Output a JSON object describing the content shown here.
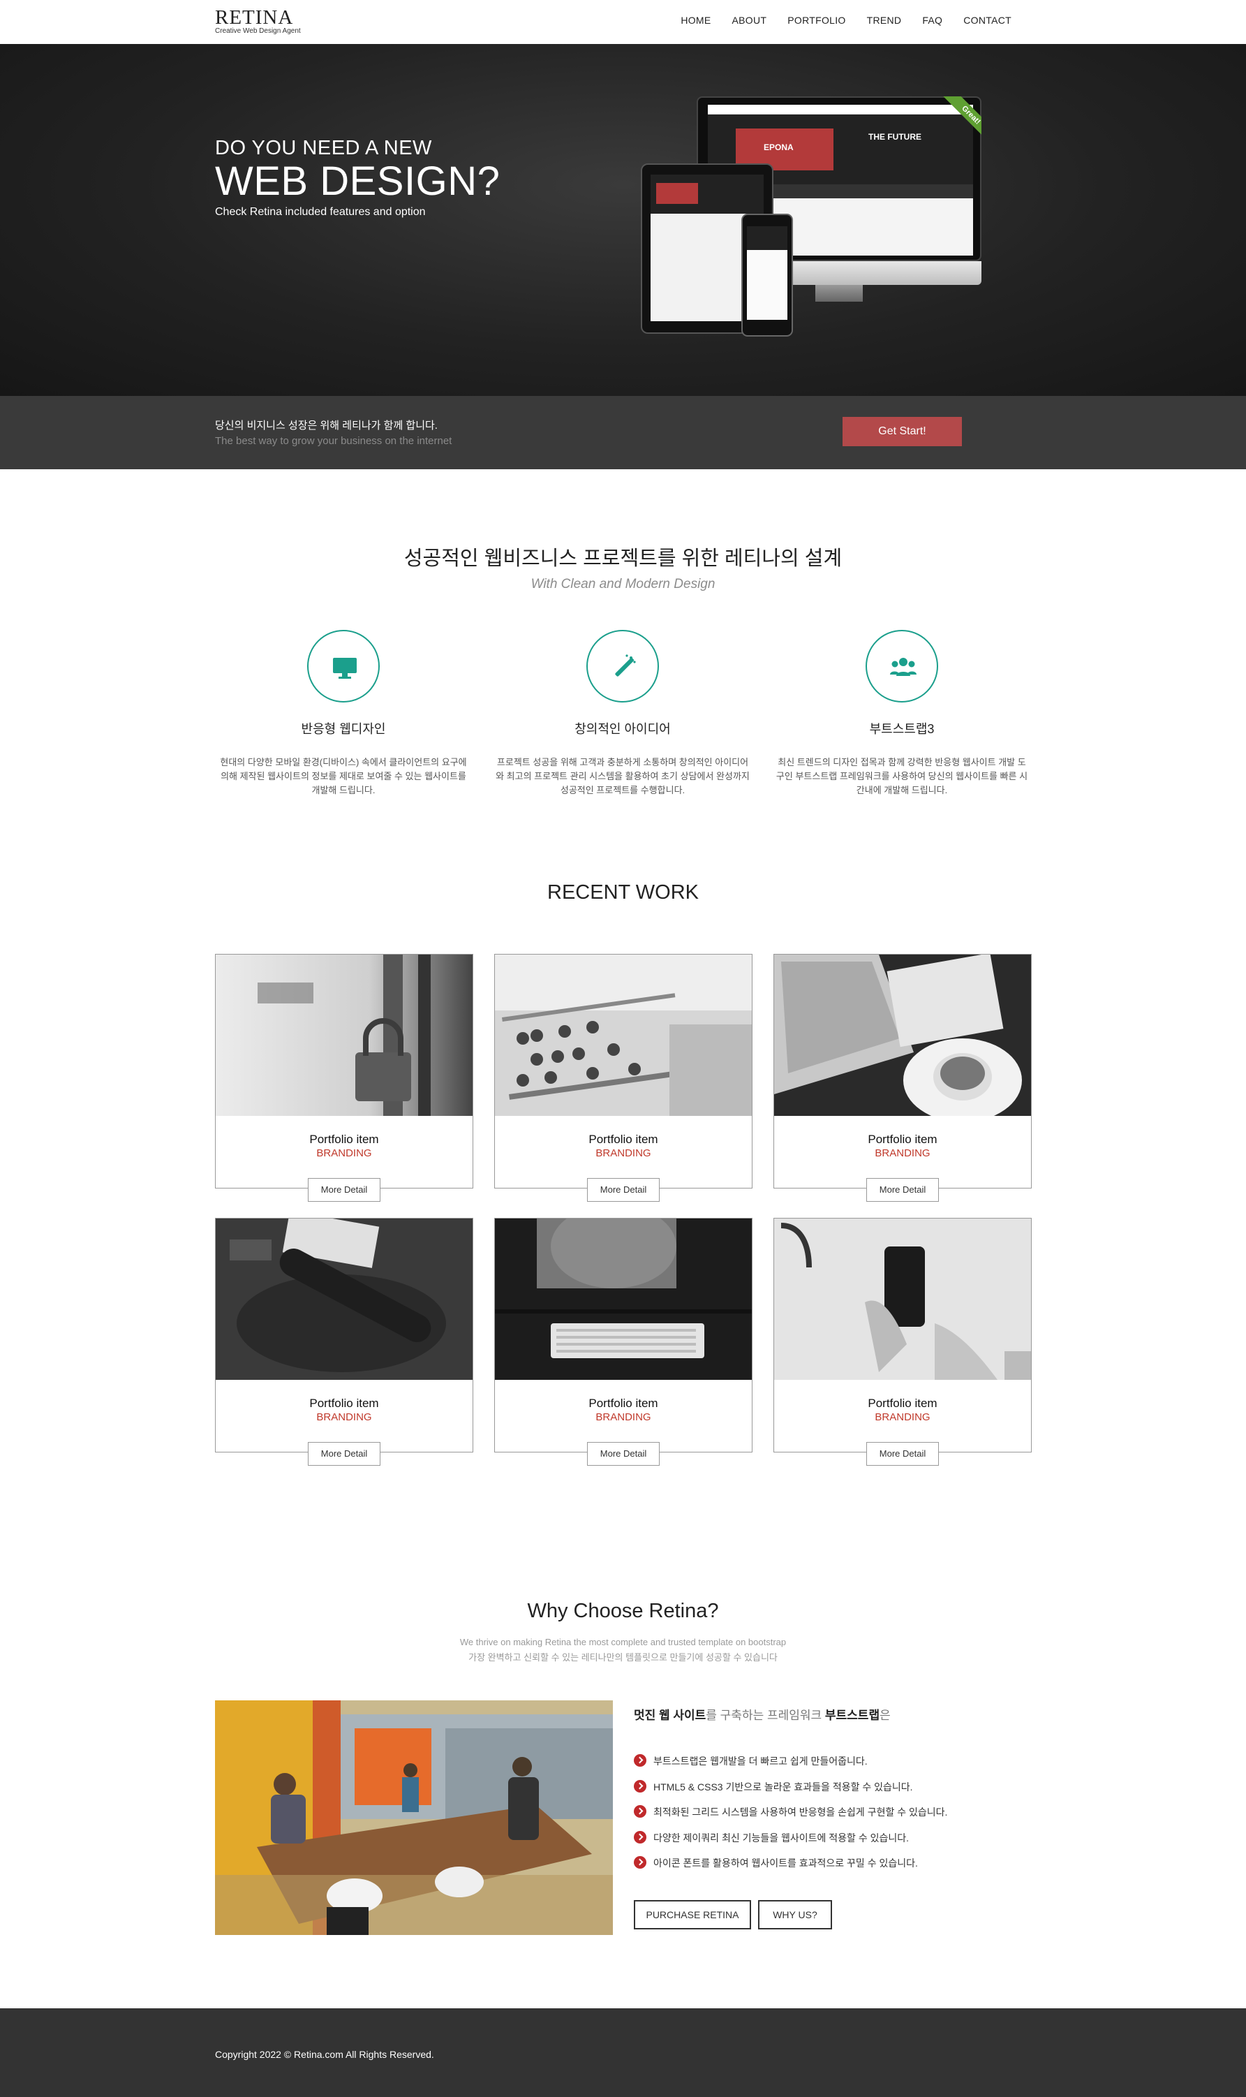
{
  "header": {
    "logo_title": "RETINA",
    "logo_sub": "Creative Web Design Agent",
    "nav": [
      "HOME",
      "ABOUT",
      "PORTFOLIO",
      "TREND",
      "FAQ",
      "CONTACT"
    ]
  },
  "hero": {
    "pre": "DO YOU NEED A NEW",
    "title": "WEB DESIGN?",
    "sub": "Check Retina included features and option",
    "ribbon": "Great!",
    "screen_brand": "EPONA",
    "screen_headline": "THE FUTURE"
  },
  "strip": {
    "kr": "당신의 비지니스 성장은 위해 레티나가 함께 합니다.",
    "en": "The best way to grow your business on the internet",
    "button": "Get Start!"
  },
  "features": {
    "title": "성공적인 웹비즈니스 프로젝트를 위한 레티나의 설계",
    "sub": "With Clean and Modern Design",
    "items": [
      {
        "icon": "monitor-icon",
        "title": "반응형 웹디자인",
        "text": "현대의 다양한 모바일 환경(디바이스) 속에서 클라이언트의 요구에 의해 제작된 웹사이트의 정보를 제대로 보여줄 수 있는 웹사이트를 개발해 드립니다."
      },
      {
        "icon": "magic-wand-icon",
        "title": "창의적인 아이디어",
        "text": "프로젝트 성공을 위해 고객과 충분하게 소통하며 창의적인 아이디어와 최고의 프로젝트 관리 시스템을 활용하여 초기 상담에서 완성까지 성공적인 프로젝트를 수행합니다."
      },
      {
        "icon": "users-icon",
        "title": "부트스트랩3",
        "text": "최신 트렌드의 디자인 접목과 함께 강력한 반응형 웹사이트 개발 도구인 부트스트랩 프레임워크를 사용하여 당신의 웹사이트를 빠른 시간내에 개발해 드립니다."
      }
    ]
  },
  "recent_work": {
    "title": "RECENT WORK",
    "items": [
      {
        "title": "Portfolio item",
        "category": "BRANDING",
        "button": "More Detail",
        "image": "padlock-photo"
      },
      {
        "title": "Portfolio item",
        "category": "BRANDING",
        "button": "More Detail",
        "image": "abacus-photo"
      },
      {
        "title": "Portfolio item",
        "category": "BRANDING",
        "button": "More Detail",
        "image": "laptop-coffee-photo"
      },
      {
        "title": "Portfolio item",
        "category": "BRANDING",
        "button": "More Detail",
        "image": "rolling-pin-photo"
      },
      {
        "title": "Portfolio item",
        "category": "BRANDING",
        "button": "More Detail",
        "image": "keyboard-photo"
      },
      {
        "title": "Portfolio item",
        "category": "BRANDING",
        "button": "More Detail",
        "image": "smartphone-photo"
      }
    ]
  },
  "why": {
    "title": "Why Choose Retina?",
    "sub_en": "We thrive on making Retina the most complete and trusted template on bootstrap",
    "sub_kr": "가장 완벽하고 신뢰할 수 있는 레티나만의 템플릿으로 만들기에 성공할 수 있습니다",
    "head_a": "멋진 웹 사이트",
    "head_b": "를 구축하는 프레임워크",
    "head_c": "부트스트랩",
    "head_d": "은",
    "list": [
      "부트스트랩은 웹개발을 더 빠르고 쉽게 만들어줍니다.",
      "HTML5 & CSS3 기반으로 놀라운 효과들을 적용할 수 있습니다.",
      "최적화된 그리드 시스템을 사용하여 반응형을 손쉽게 구현할 수 있습니다.",
      "다양한 제이쿼리 최신 기능들을 웹사이트에 적용할 수 있습니다.",
      "아이콘 폰트를 활용하여 웹사이트를 효과적으로 꾸밀 수 있습니다."
    ],
    "btn_purchase": "PURCHASE RETINA",
    "btn_why": "WHY US?"
  },
  "footer": {
    "copyright": "Copyright 2022 © Retina.com All Rights Reserved."
  },
  "colors": {
    "accent": "#1b9f8c",
    "button_red": "#b3494a",
    "category_red": "#c0392b"
  }
}
